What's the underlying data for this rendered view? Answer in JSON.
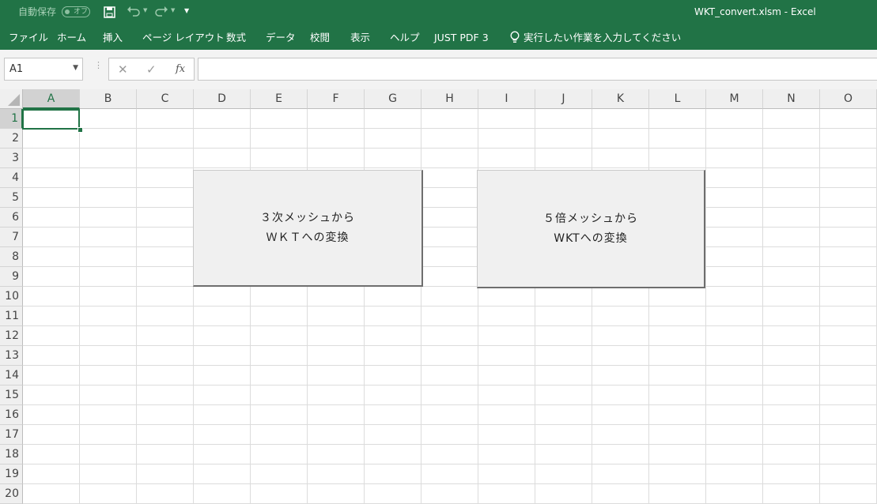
{
  "titlebar": {
    "autosave_label": "自動保存",
    "autosave_state": "オフ",
    "window_title": "WKT_convert.xlsm  -  Excel",
    "colors": {
      "ribbon": "#217346"
    }
  },
  "menu": {
    "items": [
      "ファイル",
      "ホーム",
      "挿入",
      "ページ レイアウト",
      "数式",
      "データ",
      "校閲",
      "表示",
      "ヘルプ",
      "JUST PDF 3"
    ],
    "tell_me": "実行したい作業を入力してください"
  },
  "formula_bar": {
    "name_box": "A1",
    "cancel_glyph": "✕",
    "enter_glyph": "✓",
    "fx_label": "fx",
    "formula": ""
  },
  "sheet": {
    "columns": [
      "A",
      "B",
      "C",
      "D",
      "E",
      "F",
      "G",
      "H",
      "I",
      "J",
      "K",
      "L",
      "M",
      "N",
      "O"
    ],
    "rows": [
      "1",
      "2",
      "3",
      "4",
      "5",
      "6",
      "7",
      "8",
      "9",
      "10",
      "11",
      "12",
      "13",
      "14",
      "15",
      "16",
      "17",
      "18",
      "19",
      "20"
    ],
    "active_cell": "A1"
  },
  "buttons": {
    "mesh3": {
      "line1": "３次メッシュから",
      "line2": "ＷＫＴへの変換"
    },
    "mesh5": {
      "line1": "５倍メッシュから",
      "line2": "WKTへの変換"
    }
  }
}
